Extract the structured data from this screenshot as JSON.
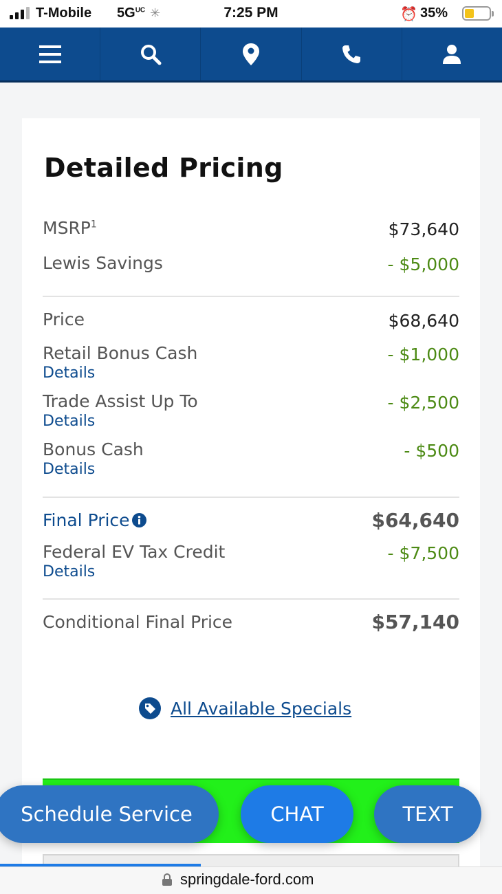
{
  "status_bar": {
    "carrier": "T-Mobile",
    "network": "5G",
    "network_sub": "UC",
    "time": "7:25 PM",
    "battery_percent": "35%",
    "battery_level": 0.35,
    "signal_bars": 3,
    "battery_color": "#f3c31a"
  },
  "navbar": {
    "color": "#0d4b8e",
    "items": [
      {
        "icon": "menu-icon"
      },
      {
        "icon": "search-icon"
      },
      {
        "icon": "location-pin-icon"
      },
      {
        "icon": "phone-icon"
      },
      {
        "icon": "user-icon"
      }
    ]
  },
  "pricing": {
    "title": "Detailed Pricing",
    "msrp_label": "MSRP",
    "msrp_footnote": "1",
    "msrp_value": "$73,640",
    "lewis_savings_label": "Lewis Savings",
    "lewis_savings_value": "- $5,000",
    "price_label": "Price",
    "price_value": "$68,640",
    "retail_bonus_label": "Retail Bonus Cash",
    "retail_bonus_value": "- $1,000",
    "trade_assist_label": "Trade Assist Up To",
    "trade_assist_value": "- $2,500",
    "bonus_cash_label": "Bonus Cash",
    "bonus_cash_value": "- $500",
    "final_price_label": "Final Price",
    "final_price_value": "$64,640",
    "ev_credit_label": "Federal EV Tax Credit",
    "ev_credit_value": "- $7,500",
    "conditional_label": "Conditional Final Price",
    "conditional_value": "$57,140",
    "details_label": "Details",
    "discount_color": "#4c8a14",
    "link_color": "#0d4b8e"
  },
  "specials": {
    "icon": "tag-icon",
    "label": "All Available Specials"
  },
  "floating_buttons": {
    "schedule_service": "Schedule Service",
    "chat": "CHAT",
    "text": "TEXT"
  },
  "banner": {
    "color": "#22f01a"
  },
  "url_bar": {
    "url": "springdale-ford.com",
    "icon": "lock-icon"
  }
}
